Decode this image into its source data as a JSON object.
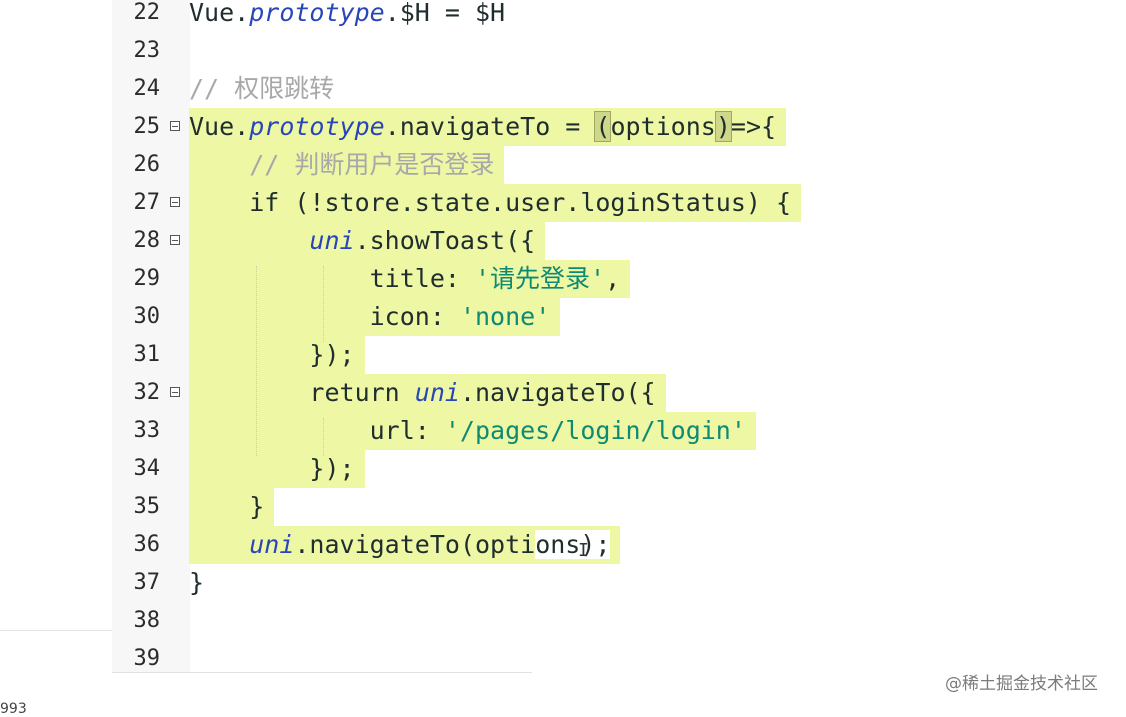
{
  "editor": {
    "lines": [
      {
        "number": "22",
        "segments": [
          {
            "t": "Vue.",
            "c": "kw"
          },
          {
            "t": "prototype",
            "c": "it"
          },
          {
            "t": ".$H = $H",
            "c": "kw"
          }
        ]
      },
      {
        "number": "23",
        "segments": []
      },
      {
        "number": "24",
        "segments": [
          {
            "t": "// 权限跳转",
            "c": "cm"
          }
        ]
      },
      {
        "number": "25",
        "fold": true,
        "segments": [
          {
            "t": "Vue.",
            "c": "kw"
          },
          {
            "t": "prototype",
            "c": "it"
          },
          {
            "t": ".navigateTo = ",
            "c": "kw"
          },
          {
            "t": "(",
            "c": "kw",
            "box": true
          },
          {
            "t": "options",
            "c": "kw"
          },
          {
            "t": ")",
            "c": "kw",
            "box": true
          },
          {
            "t": "=>{",
            "c": "kw"
          }
        ],
        "highlight": true
      },
      {
        "number": "26",
        "segments": [
          {
            "t": "    // 判断用户是否登录",
            "c": "cm"
          }
        ],
        "highlight": true
      },
      {
        "number": "27",
        "fold": true,
        "segments": [
          {
            "t": "    if (!store.state.user.loginStatus) {",
            "c": "kw"
          }
        ],
        "highlight": true
      },
      {
        "number": "28",
        "fold": true,
        "segments": [
          {
            "t": "        ",
            "c": "kw"
          },
          {
            "t": "uni",
            "c": "it"
          },
          {
            "t": ".showToast({",
            "c": "kw"
          }
        ],
        "highlight": true
      },
      {
        "number": "29",
        "segments": [
          {
            "t": "            title: ",
            "c": "kw"
          },
          {
            "t": "'请先登录'",
            "c": "str"
          },
          {
            "t": ",",
            "c": "kw"
          }
        ],
        "highlight": true
      },
      {
        "number": "30",
        "segments": [
          {
            "t": "            icon: ",
            "c": "kw"
          },
          {
            "t": "'none'",
            "c": "str"
          }
        ],
        "highlight": true
      },
      {
        "number": "31",
        "segments": [
          {
            "t": "        });",
            "c": "kw"
          }
        ],
        "highlight": true
      },
      {
        "number": "32",
        "fold": true,
        "segments": [
          {
            "t": "        return ",
            "c": "kw"
          },
          {
            "t": "uni",
            "c": "it"
          },
          {
            "t": ".navigateTo({",
            "c": "kw"
          }
        ],
        "highlight": true
      },
      {
        "number": "33",
        "segments": [
          {
            "t": "            url: ",
            "c": "kw"
          },
          {
            "t": "'/pages/login/login'",
            "c": "str"
          }
        ],
        "highlight": true
      },
      {
        "number": "34",
        "segments": [
          {
            "t": "        });",
            "c": "kw"
          }
        ],
        "highlight": true
      },
      {
        "number": "35",
        "segments": [
          {
            "t": "    }",
            "c": "kw"
          }
        ],
        "highlight": true
      },
      {
        "number": "36",
        "segments": [
          {
            "t": "    ",
            "c": "kw"
          },
          {
            "t": "uni",
            "c": "it"
          },
          {
            "t": ".navigateTo(opti",
            "c": "kw"
          },
          {
            "t": "ons);",
            "c": "kw",
            "nohl": true
          }
        ],
        "highlight": true
      },
      {
        "number": "37",
        "segments": [
          {
            "t": "}",
            "c": "kw"
          }
        ]
      },
      {
        "number": "38",
        "segments": []
      },
      {
        "number": "39",
        "segments": []
      }
    ]
  },
  "watermark": "@稀土掘金技术社区",
  "corner_text": "993",
  "colors": {
    "highlight": "#edf7a4",
    "string": "#0f8a72",
    "italic_identifier": "#2846b8",
    "comment": "#a8a8a8"
  }
}
